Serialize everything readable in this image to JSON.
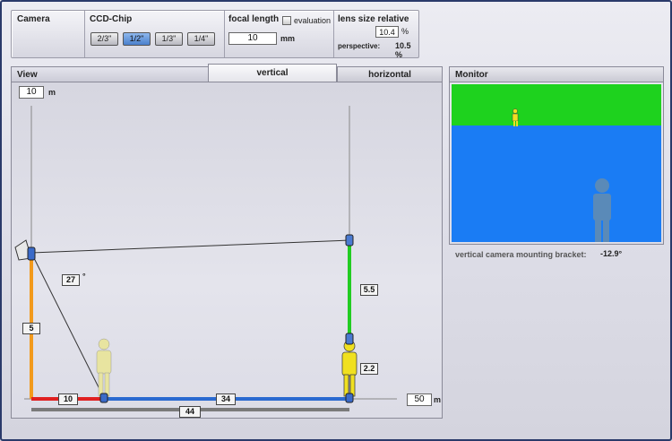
{
  "toolbar": {
    "camera_label": "Camera",
    "ccd_label": "CCD-Chip",
    "ccd_options": [
      "2/3\"",
      "1/2\"",
      "1/3\"",
      "1/4\""
    ],
    "ccd_selected": "1/2\"",
    "focal_label": "focal length",
    "evaluation_label": "evaluation",
    "focal_value": "10",
    "focal_unit": "mm",
    "lens_label": "lens size relative",
    "lens_value": "10.4",
    "lens_unit": "%",
    "perspective_label": "perspective:",
    "perspective_value": "10.5 %"
  },
  "view": {
    "panel_label": "View",
    "tabs": [
      "vertical",
      "horizontal"
    ],
    "active_tab": "vertical",
    "height_value": "10",
    "height_unit": "m",
    "distance_value": "50",
    "distance_unit": "m",
    "angle_value": "27",
    "angle_unit": "°",
    "camera_height": "5",
    "near_distance": "10",
    "mid_distance": "34",
    "total_distance": "44",
    "target_height": "5.5",
    "person_height": "2.2"
  },
  "monitor": {
    "panel_label": "Monitor",
    "bracket_label": "vertical camera mounting bracket:",
    "bracket_value": "-12.9°"
  },
  "colors": {
    "orange_line": "#f29a1c",
    "red_line": "#e02020",
    "blue_line": "#2a6ad0",
    "green_line": "#22cc22",
    "monitor_green": "#1ed21e",
    "monitor_blue": "#1a7cf4",
    "person_yellow": "#f0e020",
    "person_fill": "#e8e4a0"
  }
}
